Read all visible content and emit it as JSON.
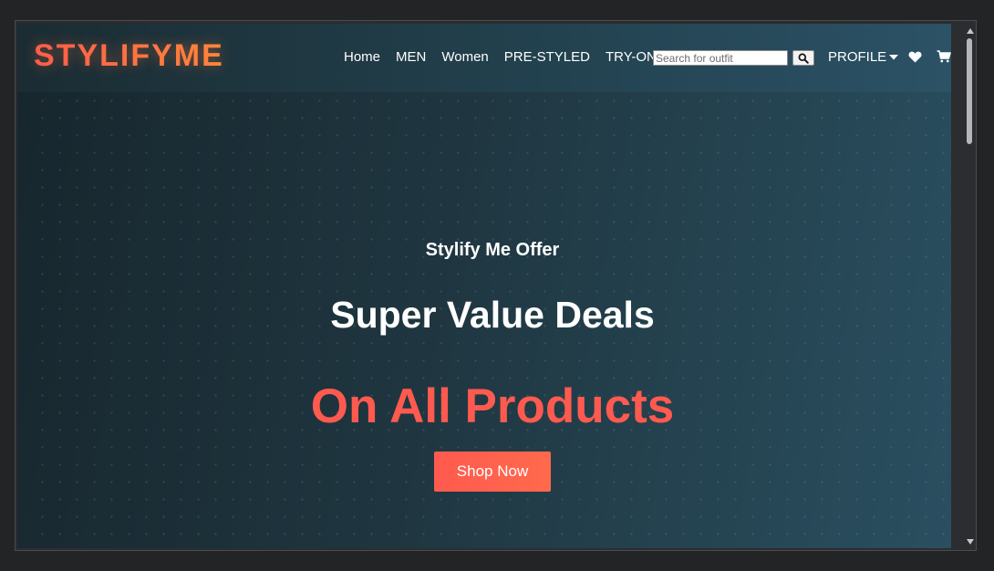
{
  "navbar": {
    "logo": "STYLIFYME",
    "links": [
      {
        "label": "Home"
      },
      {
        "label": "MEN"
      },
      {
        "label": "Women"
      },
      {
        "label": "PRE-STYLED"
      },
      {
        "label": "TRY-ON"
      }
    ],
    "search": {
      "placeholder": "Search for outfit",
      "value": "",
      "button_icon": "search-icon"
    },
    "profile_label": "PROFILE",
    "icons": [
      "caret-down-icon",
      "heart-icon",
      "cart-icon"
    ]
  },
  "hero": {
    "offer": "Stylify Me Offer",
    "title": "Super Value Deals",
    "subtitle": "On All Products",
    "cta_label": "Shop Now"
  },
  "colors": {
    "accent": "#ff5a4f",
    "logo_gradient_start": "#ff5a4e",
    "logo_gradient_end": "#ff8a3d",
    "background_dark": "#17262d",
    "background_light": "#2a4f60",
    "text": "#ffffff"
  }
}
